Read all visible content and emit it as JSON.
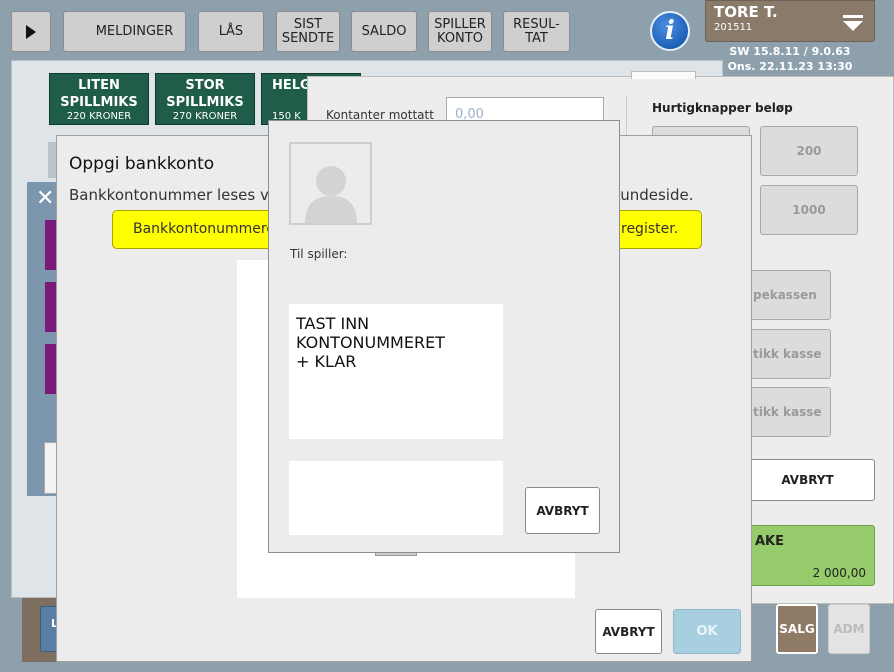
{
  "topbar": {
    "play_icon": "play-icon",
    "buttons": [
      "MELDINGER",
      "LÅS",
      "SIST\nSENDTE",
      "SALDO",
      "SPILLER\nKONTO",
      "RESUL-\nTAT"
    ],
    "info_icon": "i"
  },
  "user": {
    "name": "TORE T.",
    "id": "201511",
    "menu_icon": "chevron-down-icon"
  },
  "status": {
    "version": "SW 15.8.11 / 9.0.63",
    "datetime": "Ons. 22.11.23 13:30"
  },
  "games": [
    {
      "title": "LITEN\nSPILLMIKS",
      "price": "220 KRONER"
    },
    {
      "title": "STOR\nSPILLMIKS",
      "price": "270 KRONER"
    },
    {
      "title": "HELG",
      "price": "150 K"
    }
  ],
  "payment": {
    "cash_label": "Kontanter mottatt",
    "cash_value": "0,00",
    "quick_label": "Hurtigknapper beløp",
    "quick_amounts": [
      "200",
      "1000"
    ],
    "side_buttons": [
      "pekassen",
      "tikk kasse",
      "tikk kasse"
    ],
    "cancel": "AVBRYT",
    "total_label": "AKE",
    "total_value": "2 000,00"
  },
  "bottom": {
    "salg": "SALG",
    "adm": "ADM",
    "left_partial": "L"
  },
  "bank_dialog": {
    "title": "Oppgi bankkonto",
    "info_left": "Bankkontonummer leses vee",
    "info_right": "kundeside.",
    "warning_left": "Bankkontonummere",
    "warning_right": "register.",
    "cancel": "AVBRYT",
    "ok": "OK"
  },
  "player_dialog": {
    "avatar_icon": "person-icon",
    "to_player": "Til spiller:",
    "instruction": "TAST INN\nKONTONUMMERET\n+ KLAR",
    "cancel": "AVBRYT"
  }
}
